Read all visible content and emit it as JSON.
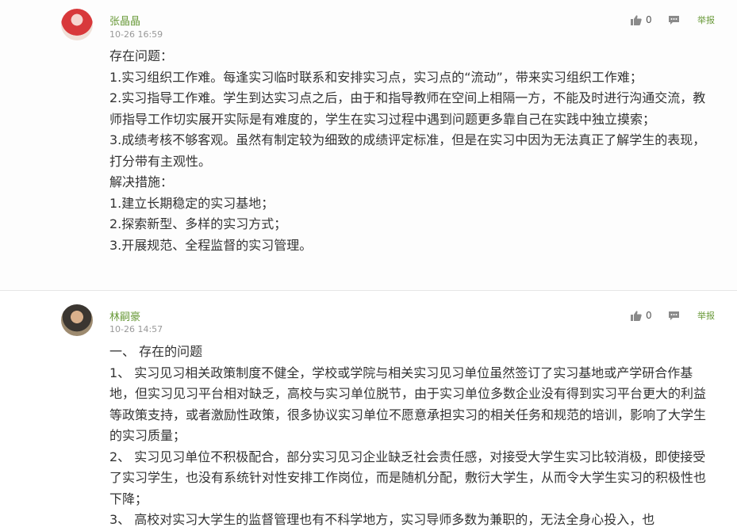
{
  "comments": [
    {
      "author": "张晶晶",
      "time": "10-26 16:59",
      "likes": "0",
      "report_label": "举报",
      "lines": [
        "存在问题：",
        "1.实习组织工作难。每逢实习临时联系和安排实习点，实习点的“流动”，带来实习组织工作难；",
        "2.实习指导工作难。学生到达实习点之后，由于和指导教师在空间上相隔一方，不能及时进行沟通交流，教师指导工作切实展开实际是有难度的，学生在实习过程中遇到问题更多靠自己在实践中独立摸索；",
        "3.成绩考核不够客观。虽然有制定较为细致的成绩评定标准，但是在实习中因为无法真正了解学生的表现，打分带有主观性。",
        "解决措施：",
        "1.建立长期稳定的实习基地；",
        "2.探索新型、多样的实习方式；",
        "3.开展规范、全程监督的实习管理。"
      ]
    },
    {
      "author": "林嗣豪",
      "time": "10-26 14:57",
      "likes": "0",
      "report_label": "举报",
      "lines": [
        "一、 存在的问题",
        "1、 实习见习相关政策制度不健全，学校或学院与相关实习见习单位虽然签订了实习基地或产学研合作基地，但实习见习平台相对缺乏，高校与实习单位脱节，由于实习单位多数企业没有得到实习平台更大的利益等政策支持，或者激励性政策，很多协议实习单位不愿意承担实习的相关任务和规范的培训，影响了大学生的实习质量；",
        "2、 实习见习单位不积极配合，部分实习见习企业缺乏社会责任感，对接受大学生实习比较消极，即使接受了实习学生，也没有系统针对性安排工作岗位，而是随机分配，敷衍大学生，从而令大学生实习的积极性也下降；",
        "3、 高校对实习大学生的监督管理也有不科学地方，实习导师多数为兼职的，无法全身心投入，也"
      ]
    }
  ]
}
